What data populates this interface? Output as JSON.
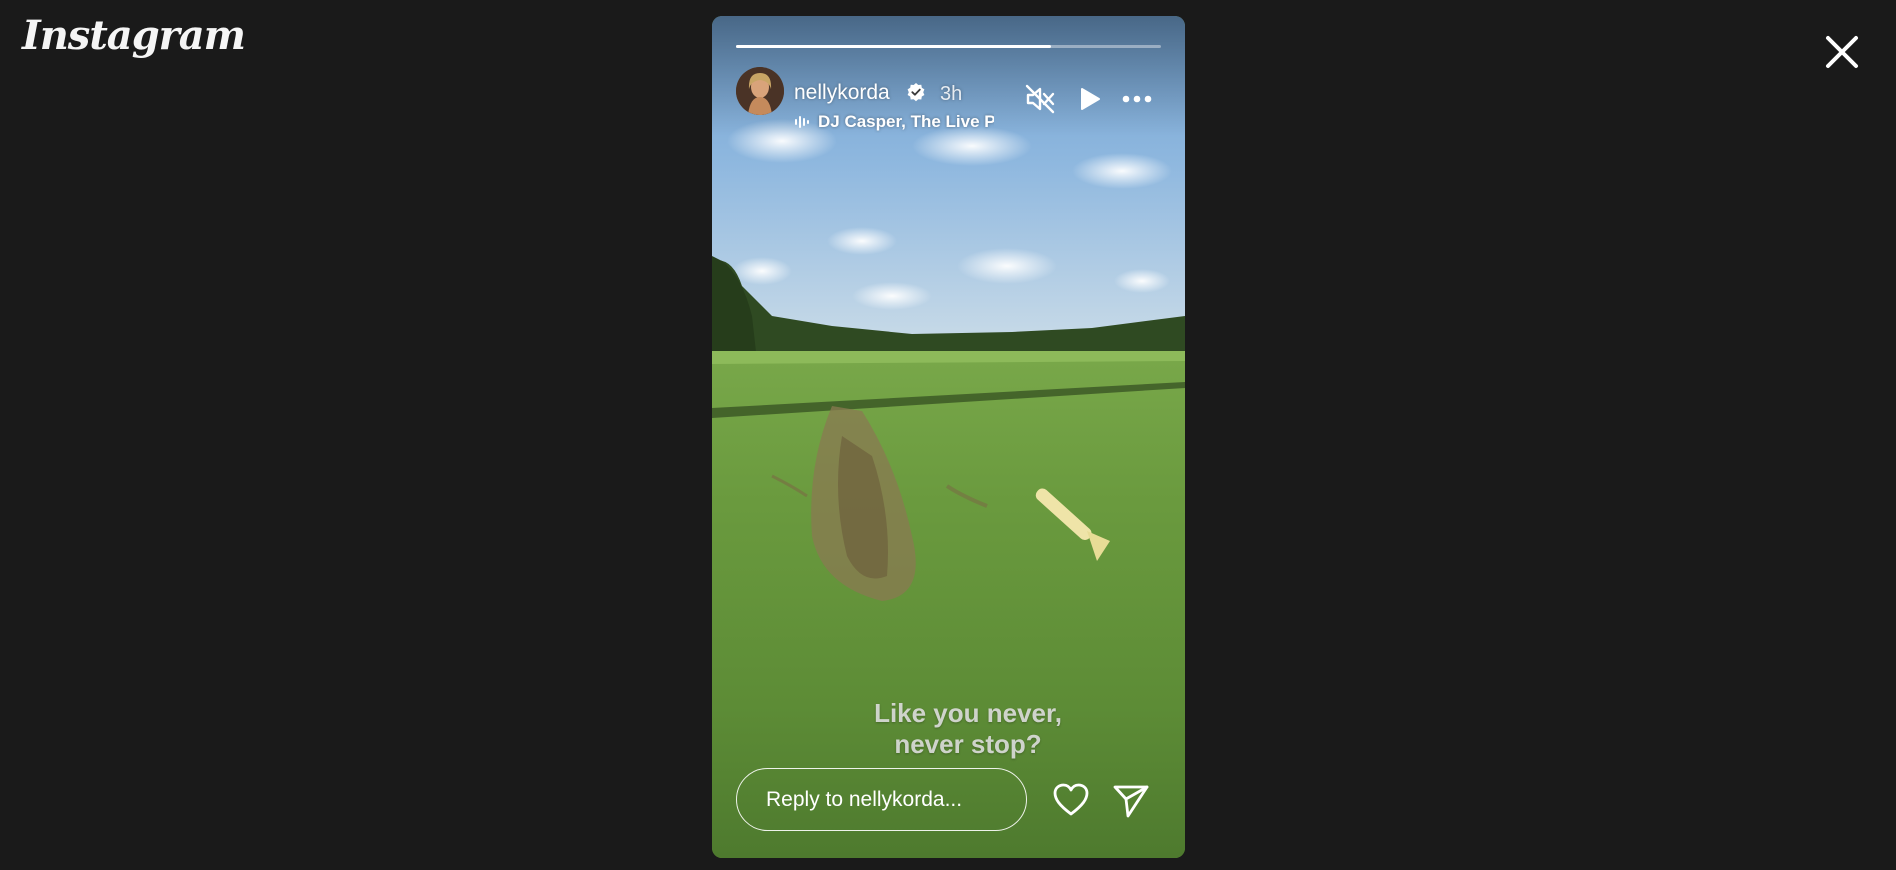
{
  "app": {
    "logo_text": "Instagram"
  },
  "story": {
    "progress_fraction": 0.74,
    "username": "nellykorda",
    "verified": true,
    "time": "3h",
    "music": "DJ Casper, The Live Pl",
    "caption_line1": "Like you never,",
    "caption_line2": "never stop?",
    "reply_placeholder": "Reply to nellykorda..."
  },
  "icons": {
    "close": "close-icon",
    "verified": "verified-badge-icon",
    "music": "audio-wave-icon",
    "mute": "muted-speaker-icon",
    "play": "play-icon",
    "more": "more-options-icon",
    "like": "heart-icon",
    "share": "send-icon"
  },
  "colors": {
    "background": "#1a1a1a",
    "verified_badge": "#ffffff",
    "text": "#ffffff"
  }
}
